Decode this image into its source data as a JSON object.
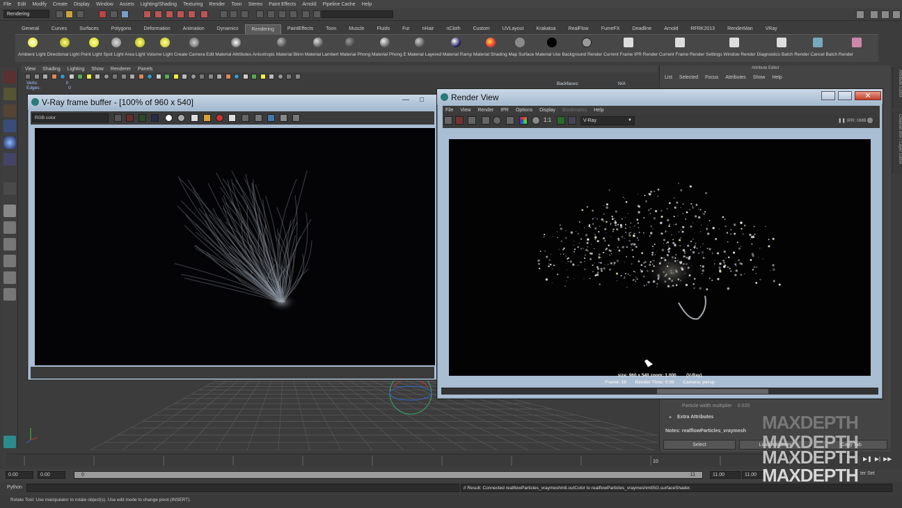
{
  "menubar": [
    "File",
    "Edit",
    "Modify",
    "Create",
    "Display",
    "Window",
    "Assets",
    "Lighting/Shading",
    "Texturing",
    "Render",
    "Toon",
    "Stereo",
    "Paint Effects",
    "Arnold",
    "Pipeline Cache",
    "Help"
  ],
  "mode": "Rendering",
  "shelf_tabs": [
    "General",
    "Curves",
    "Surfaces",
    "Polygons",
    "Deformation",
    "Animation",
    "Dynamics",
    "Rendering",
    "PaintEffects",
    "Toon",
    "Muscle",
    "Fluids",
    "Fur",
    "nHair",
    "nCloth",
    "Custom",
    "UVLayout",
    "Krakatoa",
    "RealFlow",
    "FumeFX",
    "Deadline",
    "Arnold",
    "RFRK2013",
    "RenderMan",
    "VRay"
  ],
  "shelf_active": "Rendering",
  "shelf_labels": "Ambient Light Directional Light Point Light Spot Light Area Light Volume Light Create Camera Edit Material Attributes Anisotropic Material Blinn Material Lambert Material Phong Material Phong E Material Layered Material Ramp Material Shading Map Surface Material Use Background Render Current Frame IPR Render Current Frame Render Settings Window Render Diagnostics Batch Render Cancel Batch Render",
  "panel_menu": [
    "View",
    "Shading",
    "Lighting",
    "Show",
    "Renderer",
    "Panels"
  ],
  "hud": {
    "verts_label": "Verts:",
    "edges_label": "Edges:",
    "zero": "0",
    "backface_label": "Backfaces:",
    "backface_value": "N/A"
  },
  "attribute_editor": {
    "title": "Attribute Editor",
    "menu": [
      "List",
      "Selected",
      "Focus",
      "Attributes",
      "Show",
      "Help"
    ],
    "side_tab": "Channel Box / Layer Editor",
    "side_tab2": "Attribute Editor",
    "particle_row": "Particle width multiplier",
    "particle_value": "0.020",
    "extra_attributes": "Extra Attributes",
    "notes": "Notes: realflowParticles_vraymesh",
    "select_button": "Select",
    "load_button": "Load Attributes",
    "copy_tab": "Copy Tab"
  },
  "vfb": {
    "title": "V-Ray frame buffer - [100% of 960 x 540]",
    "channel": "RGB color"
  },
  "render_view": {
    "title": "Render View",
    "menu": [
      "File",
      "View",
      "Render",
      "IPR",
      "Options",
      "Display",
      "Bookmarks",
      "Help"
    ],
    "renderer": "V-Ray",
    "ratio": "1:1",
    "ipr_status": "IPR: 0MB",
    "info_line1": "size: 960 x 540 zoom: 1.000        (V-Ray)",
    "info_line2": "Frame: 10       Render Time: 0:36       Camera: persp"
  },
  "timeline": {
    "current_frame": "10",
    "range_start": "0.00",
    "range_start2": "0.00",
    "range_slider_start": "0",
    "range_slider_end": "11",
    "range_end": "11.00",
    "range_end2": "11.00",
    "char_set": "ter Set"
  },
  "command": {
    "label": "Python",
    "result": "// Result: Connected realflowParticles_vraymeshmtl.outColor to realflowParticles_vraymeshmtlSG.surfaceShader."
  },
  "help_line": "Rotate Tool: Use manipulator to rotate object(s). Use edit mode to change pivot (INSERT).",
  "watermark": "MAXDEPTH",
  "colors": {
    "accent": "#a9bdd3",
    "ui_bg": "#3c3c3c",
    "close": "#c2402b"
  }
}
